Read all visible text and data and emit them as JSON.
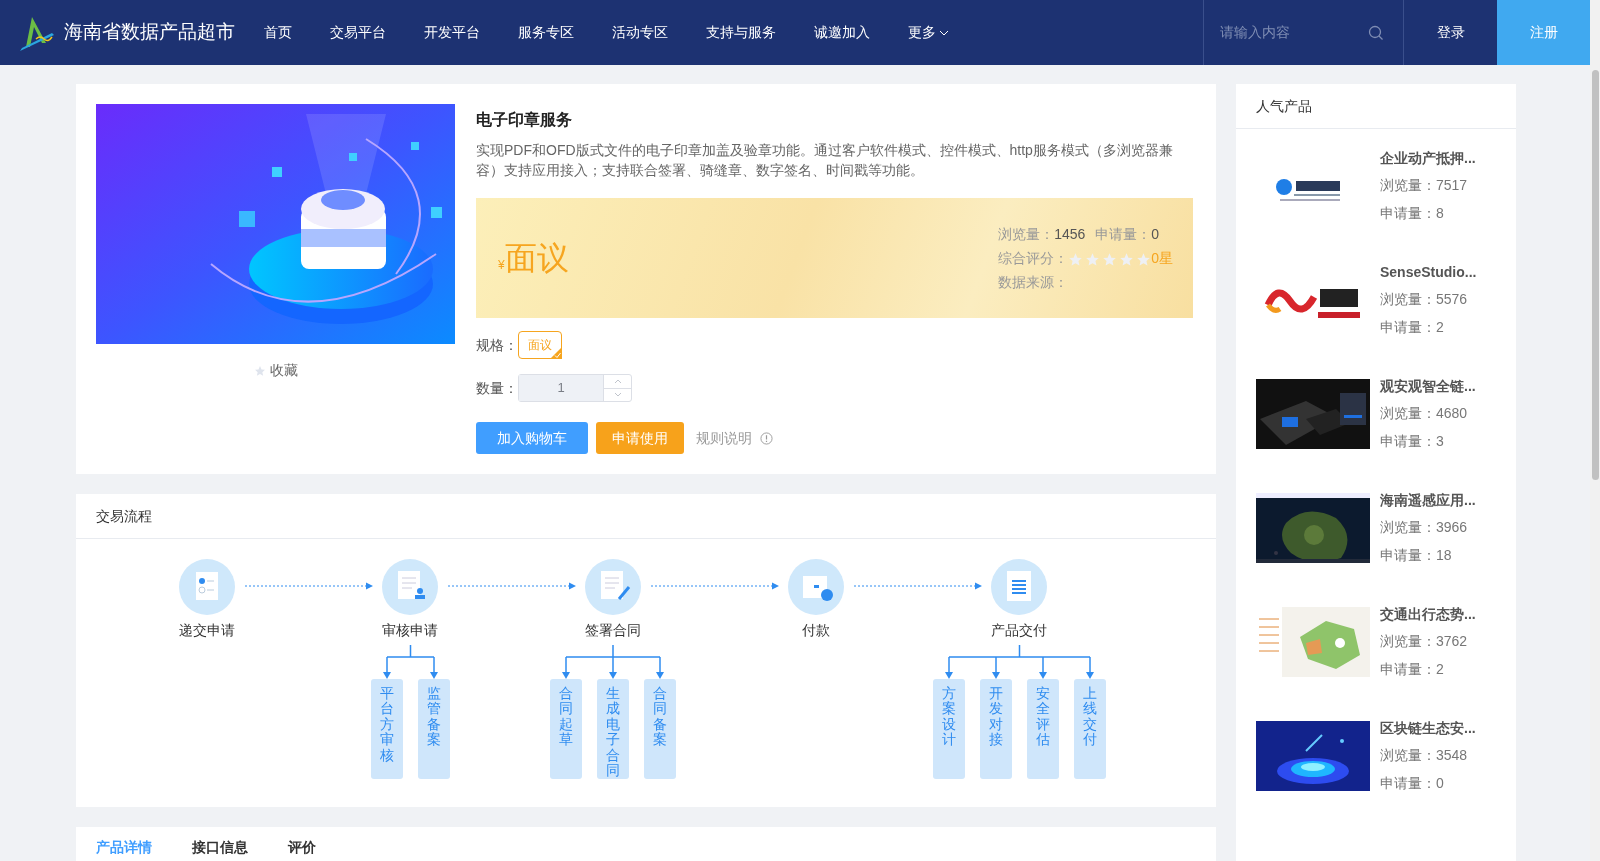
{
  "nav": {
    "brand": "海南省数据产品超市",
    "items": [
      {
        "label": "首页",
        "selected": false,
        "dropdown": false
      },
      {
        "label": "交易平台",
        "selected": false,
        "dropdown": false
      },
      {
        "label": "开发平台",
        "selected": false,
        "dropdown": false
      },
      {
        "label": "服务专区",
        "selected": false,
        "dropdown": false
      },
      {
        "label": "活动专区",
        "selected": false,
        "dropdown": false
      },
      {
        "label": "支持与服务",
        "selected": false,
        "dropdown": false
      },
      {
        "label": "诚邀加入",
        "selected": false,
        "dropdown": false
      },
      {
        "label": "更多",
        "selected": false,
        "dropdown": true
      }
    ],
    "search": {
      "placeholder": "请输入内容"
    },
    "login": "登录",
    "register": "注册"
  },
  "product": {
    "favorite": "收藏",
    "title": "电子印章服务",
    "description": "实现PDF和OFD版式文件的电子印章加盖及验章功能。通过客户软件模式、控件模式、http服务模式（多浏览器兼容）支持应用接入；支持联合签署、骑缝章、数字签名、时间戳等功能。",
    "currency": "¥",
    "price": "面议",
    "views_label": "浏览量：",
    "views": "1456",
    "applies_label": "申请量：",
    "applies": "0",
    "rating_label": "综合评分：",
    "stars": 0,
    "rating_text": "0星",
    "source_label": "数据来源：",
    "spec_label": "规格：",
    "specs": [
      {
        "label": "面议",
        "selected": true
      }
    ],
    "quantity_label": "数量：",
    "quantity": {
      "value": "1",
      "disabled": true
    },
    "add_to_cart": "加入购物车",
    "apply": "申请使用",
    "rules": "规则说明"
  },
  "process": {
    "title": "交易流程",
    "steps": [
      {
        "label": "递交申请"
      },
      {
        "label": "审核申请",
        "substeps": [
          "平台方审核",
          "监管备案"
        ]
      },
      {
        "label": "签署合同",
        "substeps": [
          "合同起草",
          "生成电子合同",
          "合同备案"
        ]
      },
      {
        "label": "付款"
      },
      {
        "label": "产品交付",
        "substeps": [
          "方案设计",
          "开发对接",
          "安全评估",
          "上线交付"
        ]
      }
    ]
  },
  "tabs": [
    {
      "label": "产品详情",
      "selected": true
    },
    {
      "label": "接口信息",
      "selected": false
    },
    {
      "label": "评价",
      "selected": false
    }
  ],
  "sidebar": {
    "title": "人气产品",
    "products": [
      {
        "title": "企业动产抵押...",
        "views": "浏览量：7517",
        "applies": "申请量：8"
      },
      {
        "title": "SenseStudio...",
        "views": "浏览量：5576",
        "applies": "申请量：2"
      },
      {
        "title": "观安观智全链...",
        "views": "浏览量：4680",
        "applies": "申请量：3"
      },
      {
        "title": "海南遥感应用...",
        "views": "浏览量：3966",
        "applies": "申请量：18"
      },
      {
        "title": "交通出行态势...",
        "views": "浏览量：3762",
        "applies": "申请量：2"
      },
      {
        "title": "区块链生态安...",
        "views": "浏览量：3548",
        "applies": "申请量：0"
      }
    ]
  }
}
